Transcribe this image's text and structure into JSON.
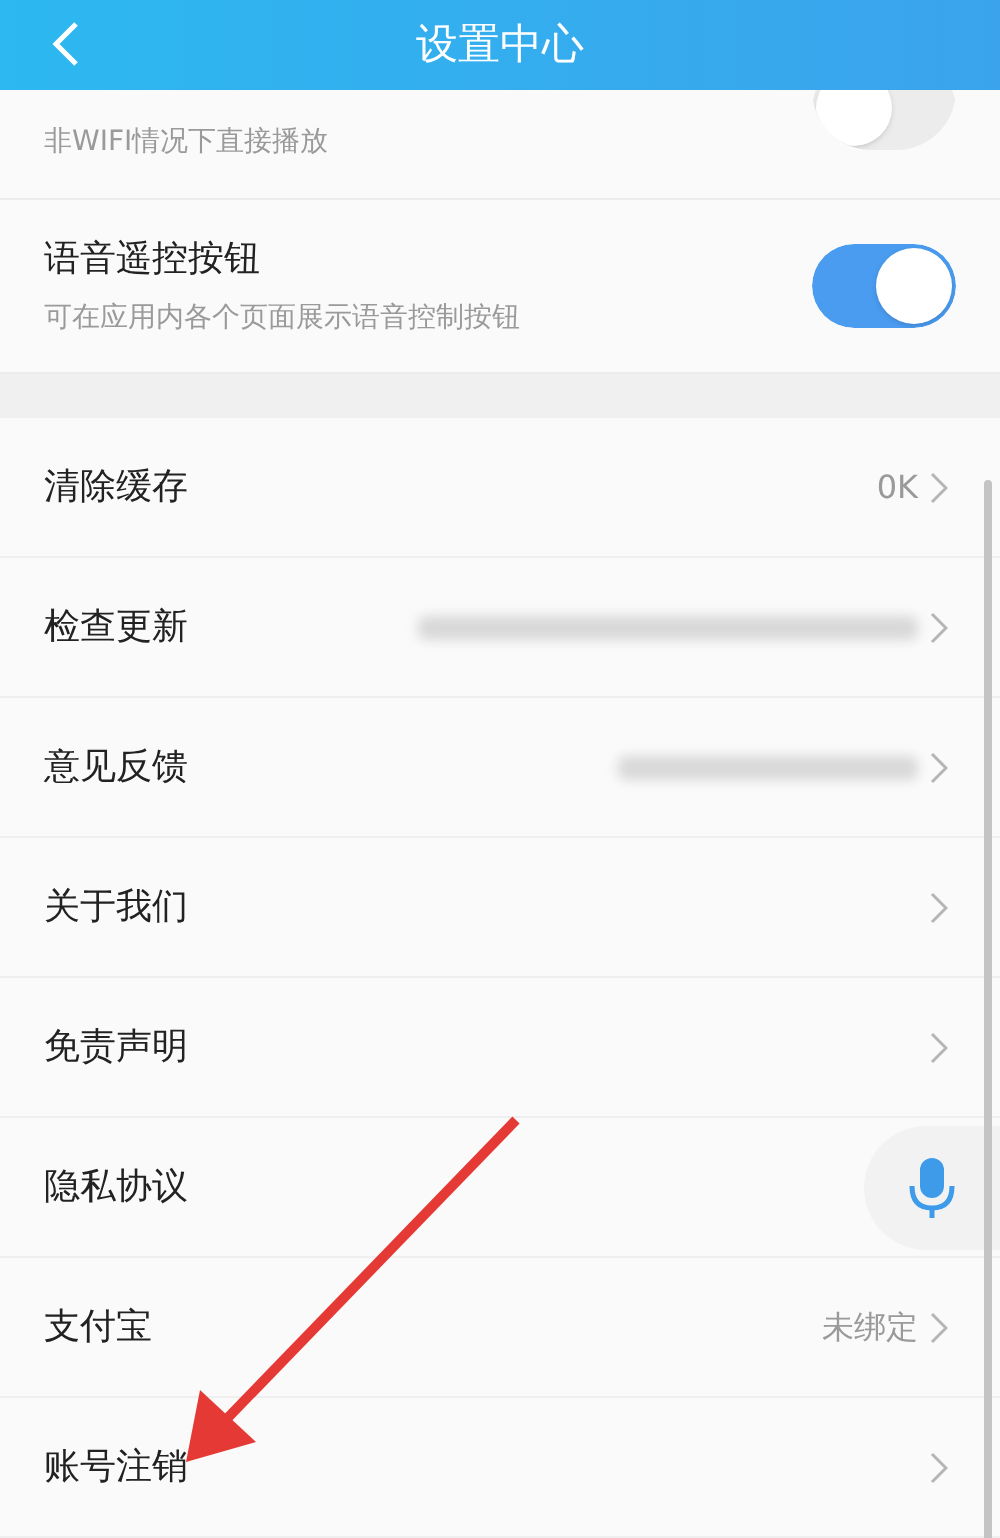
{
  "header": {
    "title": "设置中心"
  },
  "toggles": [
    {
      "subtitle": "非WIFI情况下直接播放",
      "on": false
    },
    {
      "title": "语音遥控按钮",
      "subtitle": "可在应用内各个页面展示语音控制按钮",
      "on": true
    }
  ],
  "items": [
    {
      "label": "清除缓存",
      "value": "0K"
    },
    {
      "label": "检查更新",
      "blurred": true
    },
    {
      "label": "意见反馈",
      "blurred": true
    },
    {
      "label": "关于我们"
    },
    {
      "label": "免责声明"
    },
    {
      "label": "隐私协议"
    },
    {
      "label": "支付宝",
      "value": "未绑定"
    },
    {
      "label": "账号注销"
    }
  ]
}
